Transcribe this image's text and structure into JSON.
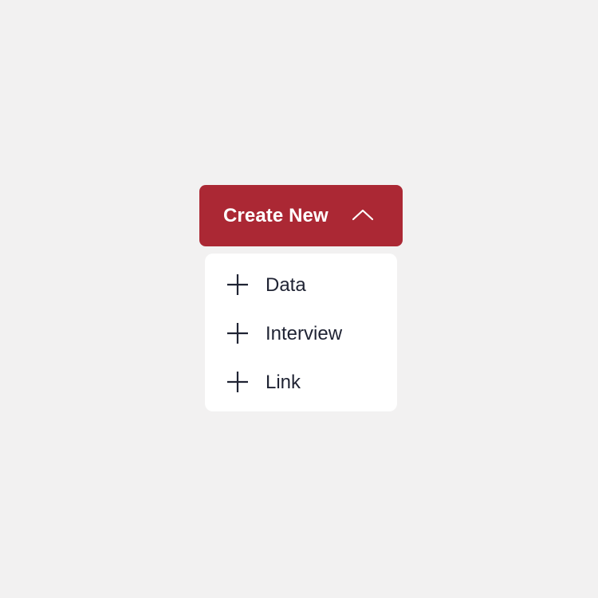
{
  "button": {
    "label": "Create New",
    "icon": "chevron-up-icon",
    "color": "#ab2834"
  },
  "menu": {
    "items": [
      {
        "label": "Data",
        "icon": "plus-icon"
      },
      {
        "label": "Interview",
        "icon": "plus-icon"
      },
      {
        "label": "Link",
        "icon": "plus-icon"
      }
    ]
  }
}
